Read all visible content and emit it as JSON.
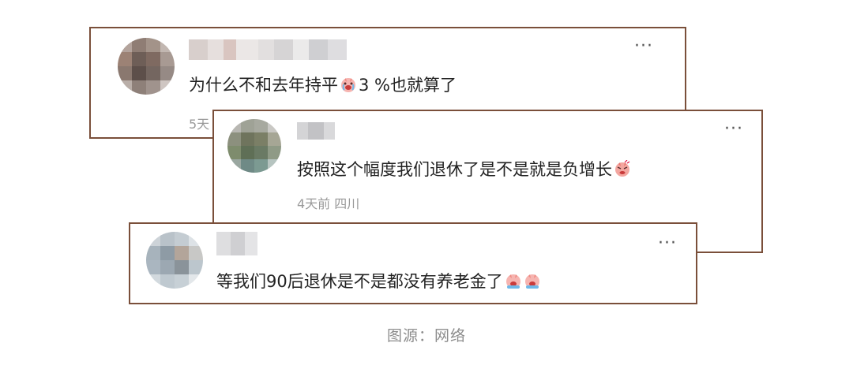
{
  "comments": [
    {
      "text_before": "为什么不和去年持平",
      "emoji": "crying-face-emoji",
      "text_after": "3 %也就算了",
      "meta": "5天",
      "more": "···"
    },
    {
      "text": "按照这个幅度我们退休了是不是就是负增长",
      "emoji": "angry-face-emoji",
      "meta": "4天前  四川",
      "more": "···"
    },
    {
      "text": "等我们90后退休是不是都没有养老金了",
      "emoji": "crying-face-emoji",
      "more": "···"
    }
  ],
  "caption": "图源：网络",
  "colors": {
    "card_border": "#7a4f3a",
    "text": "#222222",
    "meta": "#999999",
    "caption": "#8c8c8c"
  }
}
